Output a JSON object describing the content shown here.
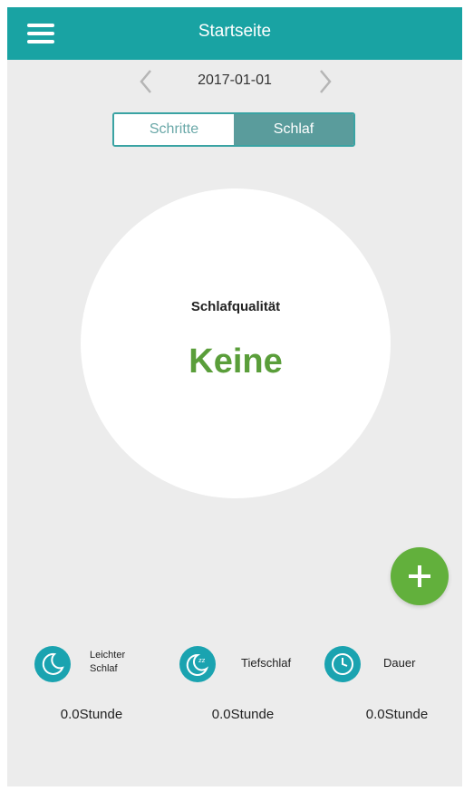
{
  "header": {
    "title": "Startseite",
    "menu_icon": "hamburger-menu-icon"
  },
  "date_nav": {
    "date": "2017-01-01",
    "prev_icon": "chevron-left-icon",
    "next_icon": "chevron-right-icon"
  },
  "tabs": [
    {
      "label": "Schritte",
      "active": false
    },
    {
      "label": "Schlaf",
      "active": true
    }
  ],
  "quality": {
    "label": "Schlafqualität",
    "value": "Keine"
  },
  "fab": {
    "icon": "plus-icon"
  },
  "stats": [
    {
      "label_line1": "Leichter",
      "label_line2": "Schlaf",
      "value": "0.0Stunde",
      "icon": "moon-icon"
    },
    {
      "label": "Tiefschlaf",
      "value": "0.0Stunde",
      "icon": "moon-zzz-icon"
    },
    {
      "label": "Dauer",
      "value": "0.0Stunde",
      "icon": "clock-icon"
    }
  ],
  "colors": {
    "header": "#19a3a3",
    "accent_green": "#62b03c",
    "quality_value": "#5a9e3a",
    "icon_teal": "#1aa3b0",
    "background": "#ececec"
  }
}
